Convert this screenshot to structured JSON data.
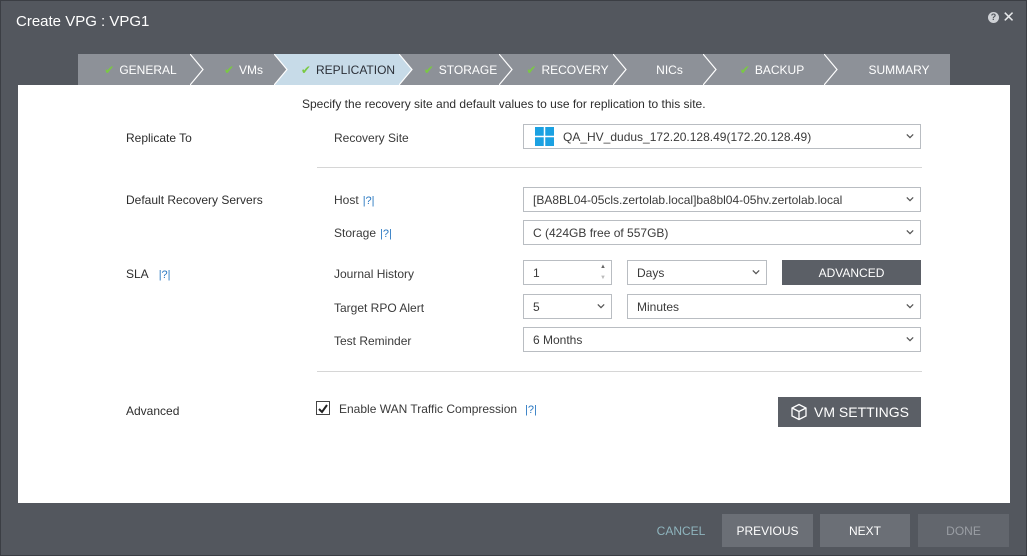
{
  "dialog": {
    "title": "Create VPG : VPG1",
    "help_icon": "?",
    "close_icon": "✕"
  },
  "wizard": {
    "steps": [
      {
        "label": "GENERAL",
        "done": true
      },
      {
        "label": "VMs",
        "done": true
      },
      {
        "label": "REPLICATION",
        "done": true,
        "active": true
      },
      {
        "label": "STORAGE",
        "done": true
      },
      {
        "label": "RECOVERY",
        "done": true
      },
      {
        "label": "NICs",
        "done": false
      },
      {
        "label": "BACKUP",
        "done": true
      },
      {
        "label": "SUMMARY",
        "done": false
      }
    ],
    "check_glyph": "✔"
  },
  "intro": "Specify the recovery site and default values to use for replication to this site.",
  "replicate_to": {
    "section": "Replicate To",
    "recovery_site_label": "Recovery Site",
    "recovery_site_value": "QA_HV_dudus_172.20.128.49(172.20.128.49)"
  },
  "servers": {
    "section": "Default Recovery Servers",
    "host_label": "Host",
    "host_value": "[BA8BL04-05cls.zertolab.local]ba8bl04-05hv.zertolab.local",
    "storage_label": "Storage",
    "storage_value": "C (424GB free of 557GB)",
    "help": "|?|"
  },
  "sla": {
    "section": "SLA",
    "help": "|?|",
    "journal_label": "Journal History",
    "journal_value": "1",
    "journal_unit": "Days",
    "advanced_button": "ADVANCED",
    "rpo_label": "Target RPO Alert",
    "rpo_value": "5",
    "rpo_unit": "Minutes",
    "test_label": "Test Reminder",
    "test_value": "6 Months"
  },
  "advanced": {
    "section": "Advanced",
    "wan_label": "Enable WAN Traffic Compression",
    "wan_checked": true,
    "help": "|?|",
    "vm_settings_button": "VM SETTINGS"
  },
  "footer": {
    "cancel": "CANCEL",
    "previous": "PREVIOUS",
    "next": "NEXT",
    "done": "DONE"
  },
  "colors": {
    "wizard_step": "#8d9198",
    "wizard_active": "#c7dbe8",
    "accent_check": "#7ac943",
    "link_blue": "#2a78c2",
    "cancel_teal": "#8fb5be"
  }
}
